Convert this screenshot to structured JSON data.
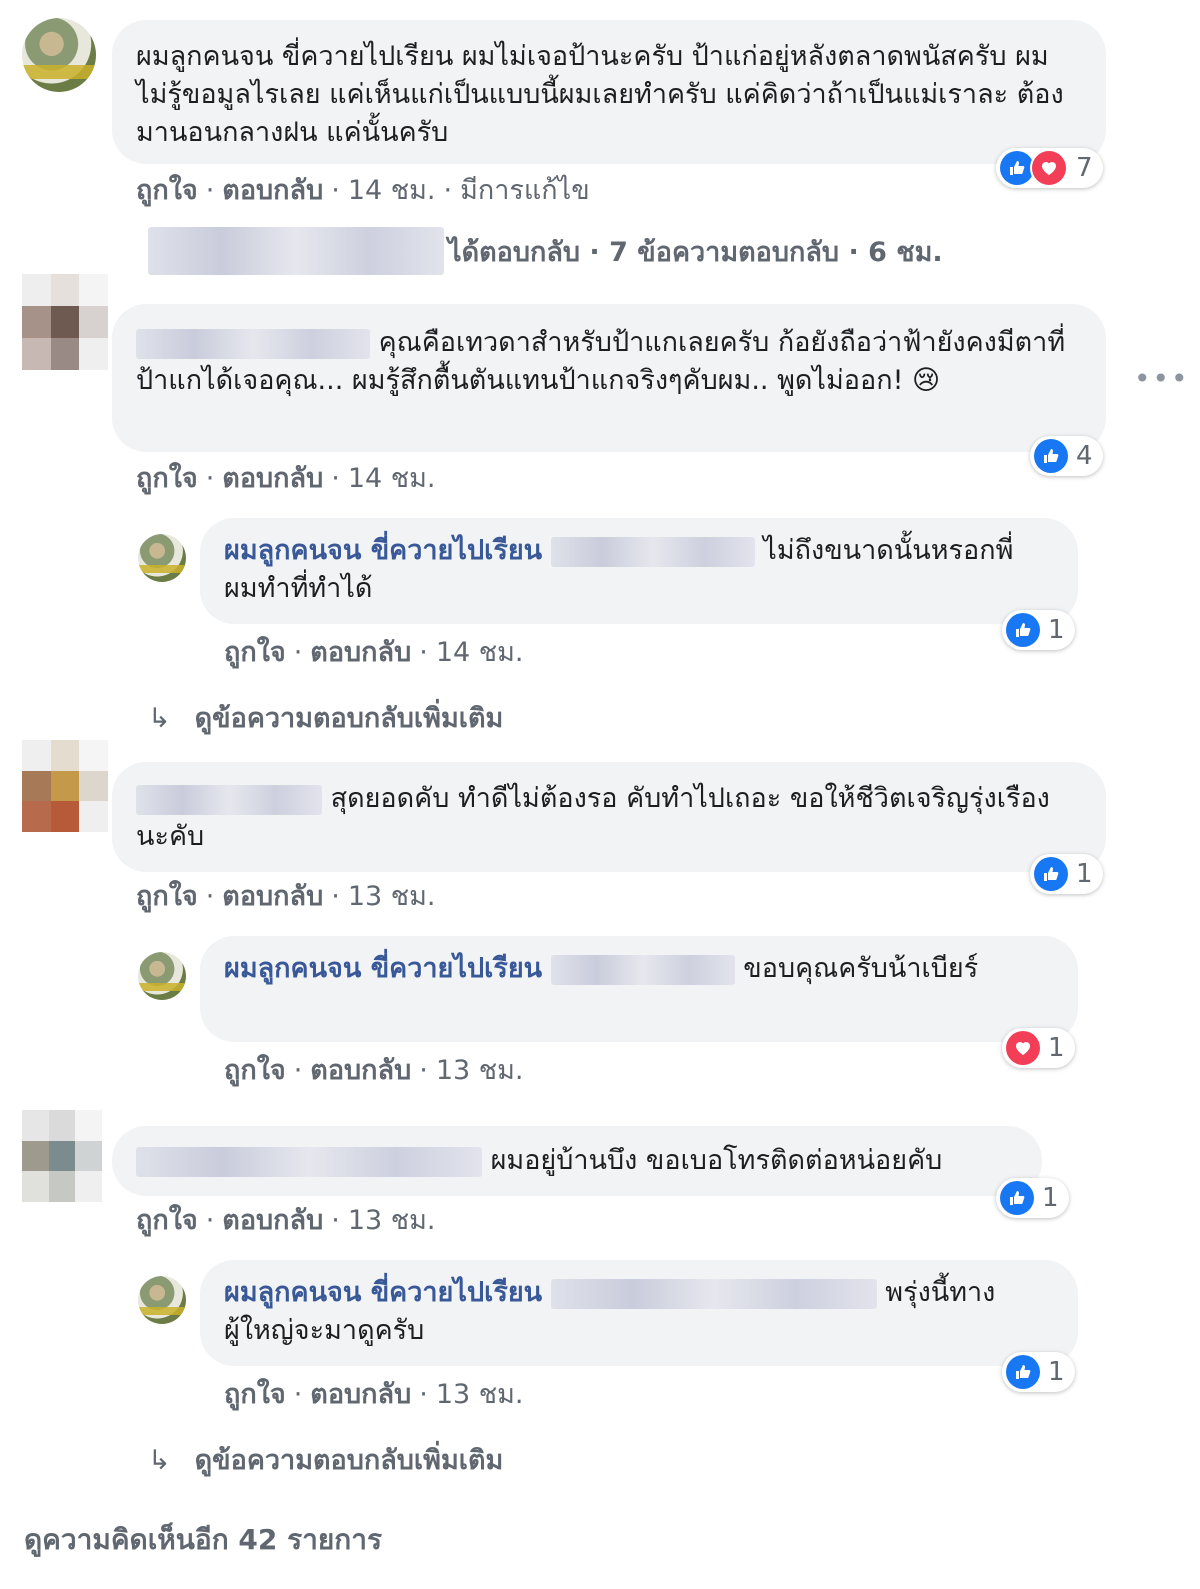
{
  "author_name": "ผมลูกคนจน ขี่ควายไปเรียน",
  "actions": {
    "like": "ถูกใจ",
    "reply": "ตอบกลับ",
    "edited": "มีการแก้ไข"
  },
  "comment1": {
    "text": "ผมลูกคนจน ขี่ควายไปเรียน ผมไม่เจอป้านะครับ ป้าแก่อยู่หลังตลาดพนัสครับ ผมไม่รู้ขอมูลไรเลย แค่เห็นแก่เป็นแบบนี้ผมเลยทำครับ แค่คิดว่าถ้าเป็นแม่เราละ ต้องมานอนกลางฝน แค่นั้นครับ",
    "time": "14 ชม.",
    "reactions": "7",
    "replied_summary": "ได้ตอบกลับ · 7 ข้อความตอบกลับ · 6 ชม."
  },
  "comment2": {
    "text": "คุณคือเทวดาสำหรับป้าแกเลยครับ ก้อยังถือว่าฟ้ายังคงมีตาที่ป้าแกได้เจอคุณ... ผมรู้สึกตื้นตันแทนป้าแกจริงๆคับผม.. พูดไม่ออก! 😢",
    "time": "14 ชม.",
    "reactions": "4",
    "reply": {
      "text": "ไม่ถึงขนาดนั้นหรอกพี่ ผมทำที่ทำได้",
      "time": "14 ชม.",
      "reactions": "1"
    },
    "more_replies": "ดูข้อความตอบกลับเพิ่มเติม"
  },
  "comment3": {
    "text": "สุดยอดคับ ทำดีไม่ต้องรอ คับทำไปเถอะ ขอให้ชีวิตเจริญรุ่งเรืองนะคับ",
    "time": "13 ชม.",
    "reactions": "1",
    "reply": {
      "text": "ขอบคุณครับน้าเบียร์",
      "time": "13 ชม.",
      "reactions": "1"
    }
  },
  "comment4": {
    "text": "ผมอยู่บ้านบึง ขอเบอโทรติดต่อหน่อยคับ",
    "time": "13 ชม.",
    "reactions": "1",
    "reply": {
      "text": "พรุ่งนี้ทางผู้ใหญ่จะมาดูครับ",
      "time": "13 ชม.",
      "reactions": "1"
    },
    "more_replies": "ดูข้อความตอบกลับเพิ่มเติม"
  },
  "view_more": "ดูความคิดเห็นอีก 42 รายการ",
  "colors": {
    "like": "#1877f2",
    "love": "#f33e58",
    "name": "#385898",
    "bubble": "#f2f3f5",
    "meta": "#606770"
  },
  "icons": {
    "like": "thumbs-up-icon",
    "love": "heart-icon",
    "more": "ellipsis-icon",
    "reply_arrow": "reply-arrow-icon"
  }
}
